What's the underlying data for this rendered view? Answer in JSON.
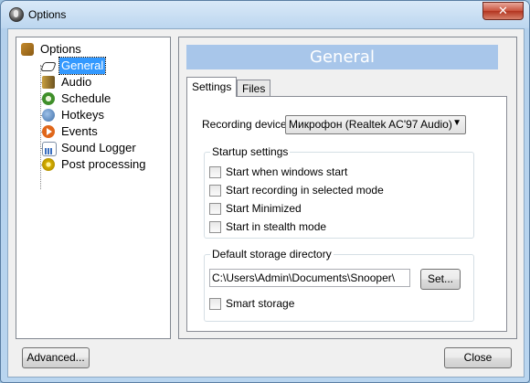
{
  "window": {
    "title": "Options",
    "close_label": "✕"
  },
  "tree": {
    "items": [
      {
        "label": "Options",
        "icon": "options-icon"
      },
      {
        "label": "General",
        "icon": "general-icon",
        "selected": true
      },
      {
        "label": "Audio",
        "icon": "audio-icon"
      },
      {
        "label": "Schedule",
        "icon": "schedule-icon"
      },
      {
        "label": "Hotkeys",
        "icon": "hotkeys-icon"
      },
      {
        "label": "Events",
        "icon": "events-icon"
      },
      {
        "label": "Sound Logger",
        "icon": "sound-logger-icon"
      },
      {
        "label": "Post processing",
        "icon": "post-processing-icon"
      }
    ]
  },
  "panel": {
    "banner": "General",
    "tabs": [
      {
        "label": "Settings",
        "active": true
      },
      {
        "label": "Files",
        "active": false
      }
    ],
    "recording_device_label": "Recording device",
    "recording_device_value": "Микрофон (Realtek AC'97 Audio)",
    "startup": {
      "title": "Startup settings",
      "options": [
        {
          "label": "Start when windows start",
          "checked": false
        },
        {
          "label": "Start recording in selected mode",
          "checked": false
        },
        {
          "label": "Start Minimized",
          "checked": false
        },
        {
          "label": "Start in stealth mode",
          "checked": false
        }
      ]
    },
    "storage": {
      "title": "Default storage directory",
      "path": "C:\\Users\\Admin\\Documents\\Snooper\\",
      "set_label": "Set...",
      "smart_storage_label": "Smart storage",
      "smart_storage_checked": false
    }
  },
  "footer": {
    "advanced_label": "Advanced...",
    "close_label": "Close"
  },
  "colors": {
    "selection": "#3399ff",
    "banner": "#a8c6ea",
    "title_gradient_top": "#d9e9f8"
  }
}
